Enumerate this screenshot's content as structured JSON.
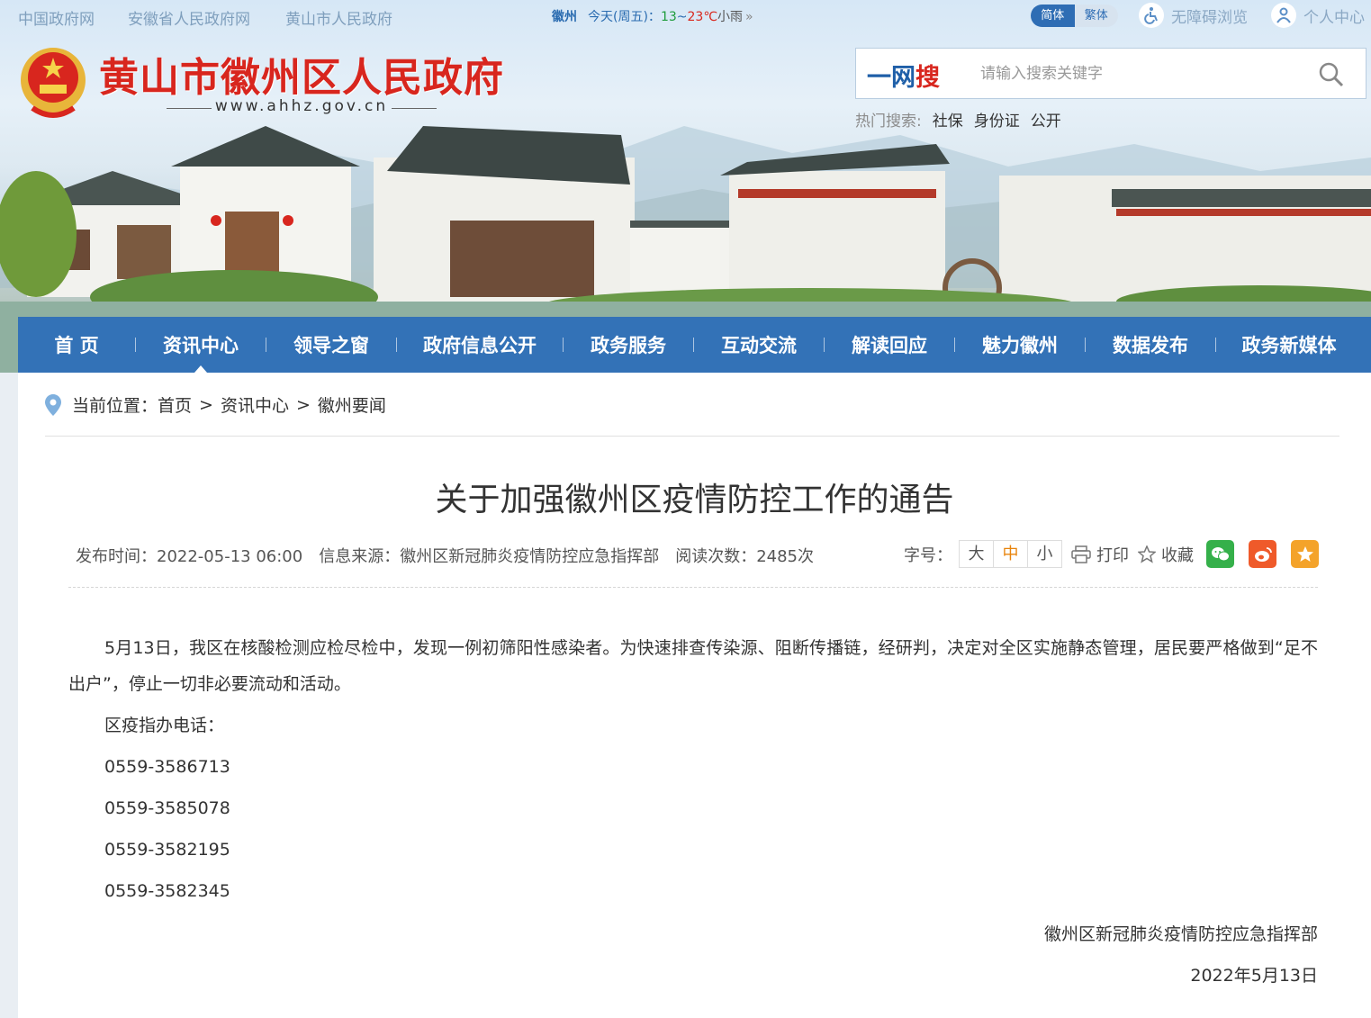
{
  "topbar": {
    "links": [
      "中国政府网",
      "安徽省人民政府网",
      "黄山市人民政府"
    ],
    "weather": {
      "city": "徽州",
      "day": "今天(周五)：",
      "low": "13",
      "sep": "~",
      "high": "23℃",
      "condition": "小雨",
      "more": "»"
    },
    "lang": {
      "simplified": "简体",
      "traditional": "繁体"
    },
    "accessibility": "无障碍浏览",
    "personal_center": "个人中心"
  },
  "header": {
    "site_title": "黄山市徽州区人民政府",
    "site_url": "www.ahhz.gov.cn",
    "search": {
      "brand_part1": "一网",
      "brand_part2": "搜",
      "placeholder": "请输入搜索关键字"
    },
    "hot_search": {
      "label": "热门搜索:",
      "terms": [
        "社保",
        "身份证",
        "公开"
      ]
    }
  },
  "nav": {
    "items": [
      "首 页",
      "资讯中心",
      "领导之窗",
      "政府信息公开",
      "政务服务",
      "互动交流",
      "解读回应",
      "魅力徽州",
      "数据发布",
      "政务新媒体"
    ],
    "active_index": 1
  },
  "breadcrumb": {
    "label": "当前位置：",
    "path": [
      "首页",
      "资讯中心",
      "徽州要闻"
    ],
    "separator": ">"
  },
  "article": {
    "title": "关于加强徽州区疫情防控工作的通告",
    "publish_time": "发布时间：2022-05-13 06:00",
    "source": "信息来源：徽州区新冠肺炎疫情防控应急指挥部",
    "read_count": "阅读次数：2485次",
    "font_size": {
      "label": "字号：",
      "large": "大",
      "medium": "中",
      "small": "小"
    },
    "print_label": "打印",
    "favorite_label": "收藏",
    "paragraph1": "5月13日，我区在核酸检测应检尽检中，发现一例初筛阳性感染者。为快速排查传染源、阻断传播链，经研判，决定对全区实施静态管理，居民要严格做到“足不出户”，停止一切非必要流动和活动。",
    "hotline_label": "区疫指办电话：",
    "phones": [
      "0559-3586713",
      "0559-3585078",
      "0559-3582195",
      "0559-3582345"
    ],
    "signature": "徽州区新冠肺炎疫情防控应急指挥部",
    "date": "2022年5月13日"
  },
  "colors": {
    "nav_blue": "#2b6cb0",
    "title_red": "#d8261e",
    "active_orange": "#e8840c"
  }
}
